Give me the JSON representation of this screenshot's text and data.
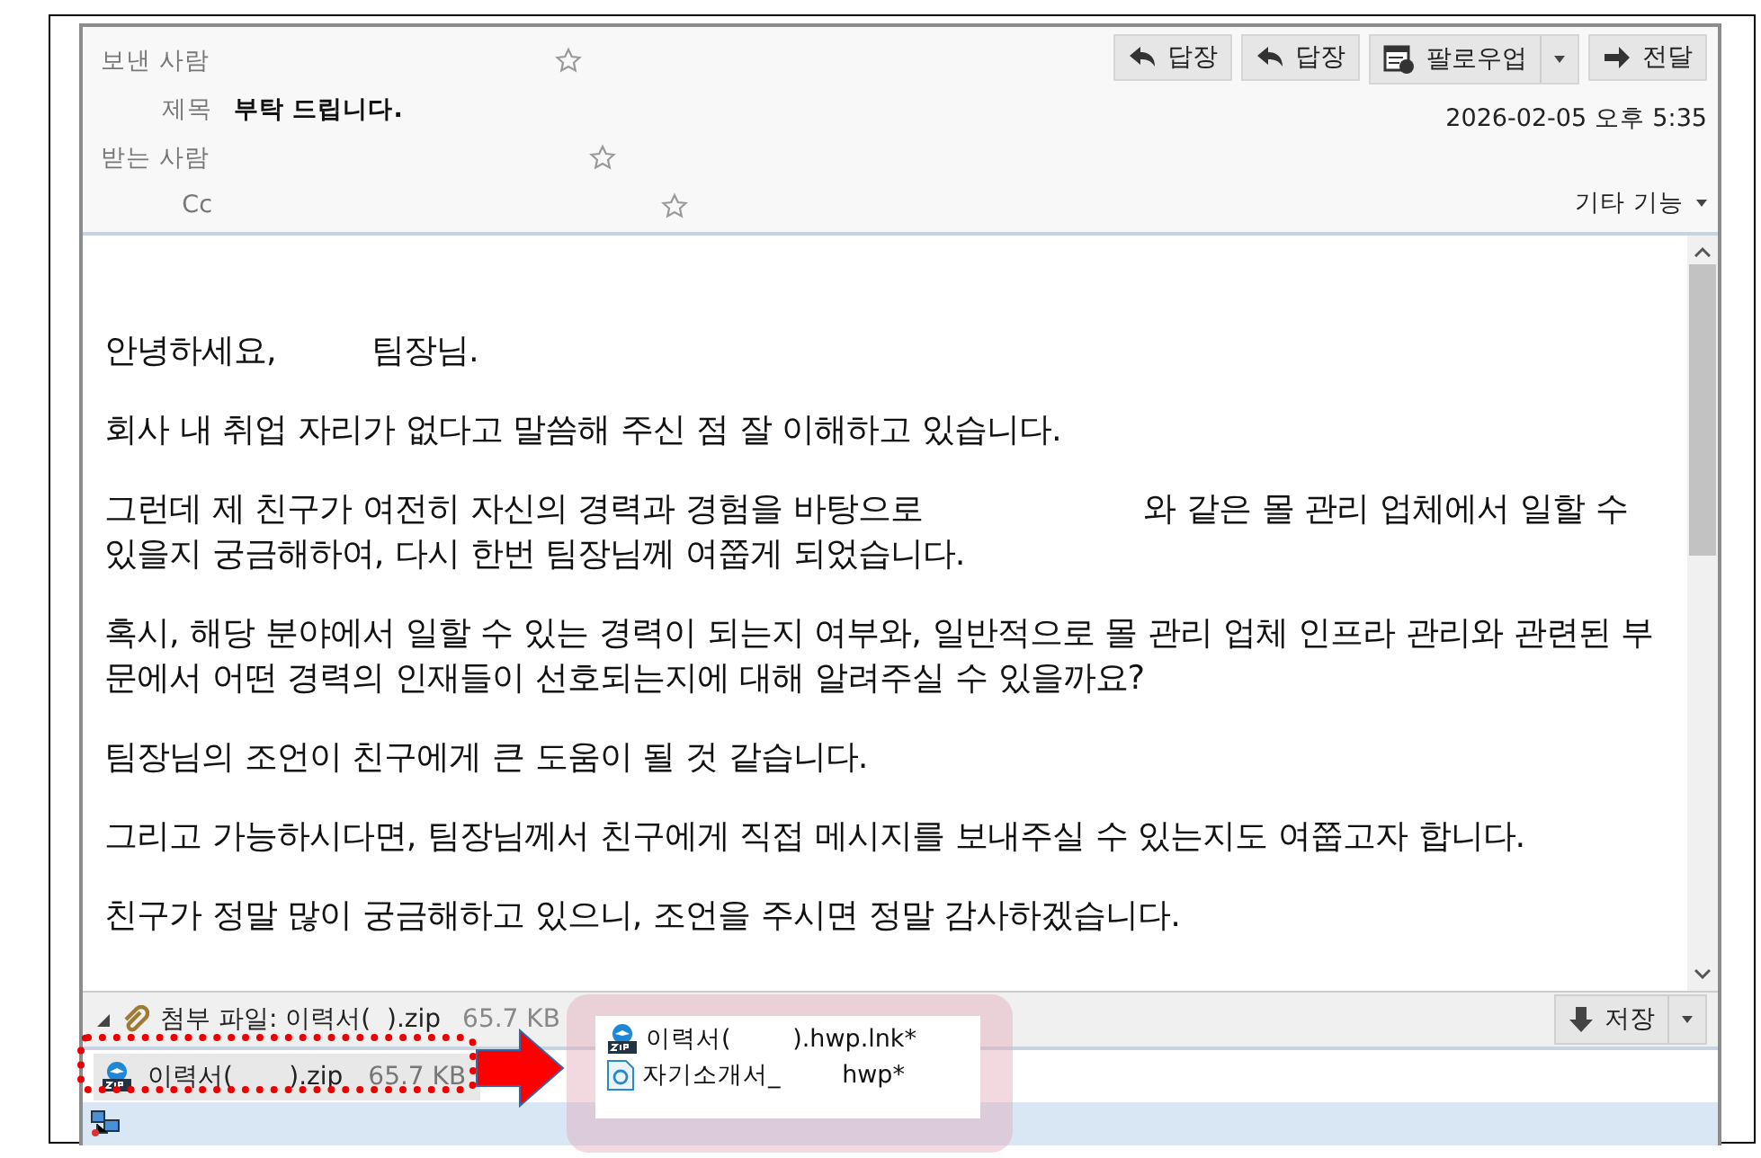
{
  "header": {
    "sender_label": "보낸 사람",
    "subject_label": "제목",
    "subject": "부탁 드립니다.",
    "to_label": "받는 사람",
    "cc_label": "Cc",
    "date": "2026-02-05 오후 5:35",
    "more_menu": "기타 기능"
  },
  "toolbar": [
    {
      "label": "답장",
      "kind": "reply"
    },
    {
      "label": "답장",
      "kind": "reply"
    },
    {
      "label": "팔로우업",
      "kind": "followup"
    },
    {
      "label": "전달",
      "kind": "forward"
    }
  ],
  "body": {
    "paragraphs": [
      "안녕하세요,         팀장님.",
      "회사 내 취업 자리가 없다고 말씀해 주신 점 잘 이해하고 있습니다.",
      "그런데 제 친구가 여전히 자신의 경력과 경험을 바탕으로                     와 같은 몰 관리 업체에서 일할 수 있을지 궁금해하여, 다시 한번 팀장님께 여쭙게 되었습니다.",
      "혹시, 해당 분야에서 일할 수 있는 경력이 되는지 여부와, 일반적으로 몰 관리 업체 인프라 관리와 관련된 부문에서 어떤 경력의 인재들이 선호되는지에 대해 알려주실 수 있을까요?",
      "팀장님의 조언이 친구에게 큰 도움이 될 것 같습니다.",
      "그리고 가능하시다면, 팀장님께서 친구에게 직접 메시지를 보내주실 수 있는지도 여쭙고자 합니다.",
      "친구가 정말 많이 궁금해하고 있으니, 조언을 주시면 정말 감사하겠습니다."
    ]
  },
  "attachments": {
    "expanded": true,
    "summary": "첨부 파일: 이력서(  ).zip",
    "summary_size": "65.7 KB",
    "save_button": "저장",
    "items": [
      {
        "name": "이력서(       ).zip",
        "size": "65.7 KB",
        "kind": "zip"
      }
    ]
  },
  "annotation": {
    "files": [
      {
        "name": "이력서(        ).hwp.lnk*",
        "kind": "zip"
      },
      {
        "name": "자기소개서_        hwp*",
        "kind": "hwp"
      }
    ]
  }
}
